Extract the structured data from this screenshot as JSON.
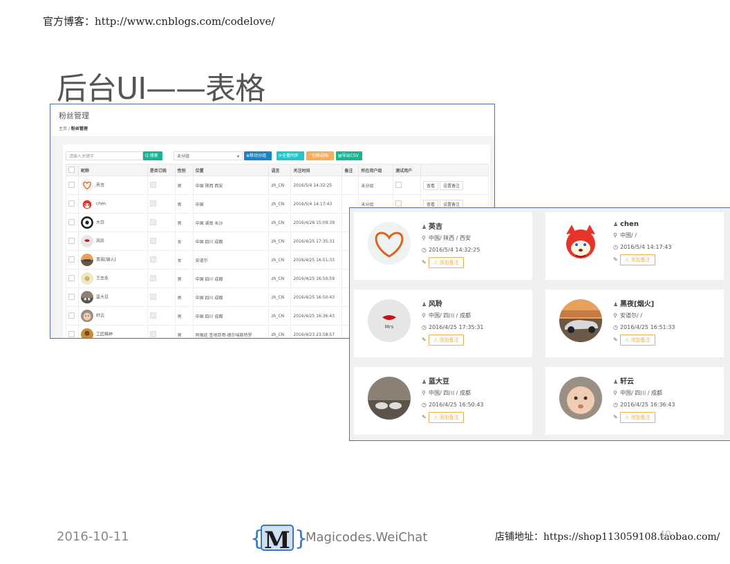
{
  "header": {
    "blog": "官方博客：http://www.cnblogs.com/codelove/"
  },
  "title": "后台UI——表格",
  "table_shot": {
    "page_title": "粉丝管理",
    "breadcrumb_home": "主页",
    "breadcrumb_sep": "/",
    "breadcrumb_current": "粉丝管理",
    "search_placeholder": "请输入关键字",
    "search_btn": "Q 搜索",
    "group_select": "未分组",
    "move_btn": "⊕移动分组",
    "sync_btn": "⟳全量同步",
    "switch_btn": "⌃切换视图",
    "export_btn": "▤导出CSV",
    "columns": [
      "",
      "昵称",
      "是否订阅",
      "性别",
      "位置",
      "语言",
      "关注时间",
      "备注",
      "所在用户组",
      "测试用户",
      ""
    ],
    "rows": [
      {
        "name": "英吉",
        "sex": "男",
        "loc": "中国 陕西 西安",
        "lang": "zh_CN",
        "time": "2016/5/4 14:32:25",
        "group": "未分组"
      },
      {
        "name": "chen",
        "sex": "男",
        "loc": "中国",
        "lang": "zh_CN",
        "time": "2016/5/4 14:17:43",
        "group": "未分组"
      },
      {
        "name": "大白",
        "sex": "男",
        "loc": "中国 湖南 长沙",
        "lang": "zh_CN",
        "time": "2016/4/28 15:09:39",
        "group": ""
      },
      {
        "name": "风聆",
        "sex": "女",
        "loc": "中国 四川 成都",
        "lang": "zh_CN",
        "time": "2016/4/25 17:35:31",
        "group": ""
      },
      {
        "name": "黑夜[烟火]",
        "sex": "女",
        "loc": "安道尔",
        "lang": "zh_CN",
        "time": "2016/4/25 16:51:33",
        "group": ""
      },
      {
        "name": "王忠永",
        "sex": "男",
        "loc": "中国 四川 成都",
        "lang": "zh_CN",
        "time": "2016/4/25 16:50:59",
        "group": ""
      },
      {
        "name": "蓝大豆",
        "sex": "男",
        "loc": "中国 四川 成都",
        "lang": "zh_CN",
        "time": "2016/4/25 16:50:43",
        "group": ""
      },
      {
        "name": "轩云",
        "sex": "男",
        "loc": "中国 四川 成都",
        "lang": "zh_CN",
        "time": "2016/4/25 16:36:43",
        "group": ""
      },
      {
        "name": "工匠精神",
        "sex": "男",
        "loc": "阿根廷 圣地亚哥-德尔埃斯特罗",
        "lang": "zh_CN",
        "time": "2016/4/23 23:58:57",
        "group": ""
      }
    ],
    "view_btn": "查看",
    "remark_btn": "设置备注"
  },
  "card_shot": {
    "add_remark": "⚠ 添加备注",
    "cards": [
      {
        "name": "英吉",
        "loc": "中国/ 陕西 / 西安",
        "time": "2016/5/4 14:32:25"
      },
      {
        "name": "chen",
        "loc": "中国/ /",
        "time": "2016/5/4 14:17:43"
      },
      {
        "name": "风聆",
        "loc": "中国/ 四川 / 成都",
        "time": "2016/4/25 17:35:31"
      },
      {
        "name": "黑夜[烟火]",
        "loc": "安道尔/ /",
        "time": "2016/4/25 16:51:33"
      },
      {
        "name": "蓝大豆",
        "loc": "中国/ 四川 / 成都",
        "time": "2016/4/25 16:50:43"
      },
      {
        "name": "轩云",
        "loc": "中国/ 四川 / 成都",
        "time": "2016/4/25 16:36:43"
      }
    ]
  },
  "footer": {
    "date": "2016-10-11",
    "logo_text": "Magicodes.WeiChat",
    "shop": "店铺地址：https://shop113059108.taobao.com/",
    "page": "40"
  },
  "colors": {
    "green": "#1ab394",
    "blue": "#1c84c6",
    "cyan": "#23c6c8",
    "orange": "#f8ac59",
    "border": "#4a6fb5"
  }
}
